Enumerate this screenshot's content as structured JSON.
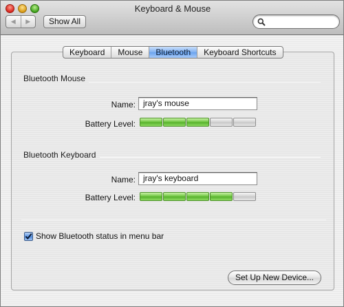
{
  "window": {
    "title": "Keyboard & Mouse"
  },
  "toolbar": {
    "back_icon": "back-arrow-icon",
    "forward_icon": "forward-arrow-icon",
    "show_all_label": "Show All",
    "search": {
      "value": "",
      "placeholder": "",
      "icon": "search-icon"
    }
  },
  "tabs": [
    {
      "label": "Keyboard",
      "active": false
    },
    {
      "label": "Mouse",
      "active": false
    },
    {
      "label": "Bluetooth",
      "active": true
    },
    {
      "label": "Keyboard Shortcuts",
      "active": false
    }
  ],
  "mouse_section": {
    "title": "Bluetooth Mouse",
    "name_label": "Name:",
    "name_value": "jray's mouse",
    "battery_label": "Battery Level:",
    "battery_segments_total": 5,
    "battery_segments_filled": 3
  },
  "keyboard_section": {
    "title": "Bluetooth Keyboard",
    "name_label": "Name:",
    "name_value": "jray's keyboard",
    "battery_label": "Battery Level:",
    "battery_segments_total": 5,
    "battery_segments_filled": 4
  },
  "status_checkbox": {
    "label": "Show Bluetooth status in menu bar",
    "checked": true
  },
  "setup_button_label": "Set Up New Device...",
  "colors": {
    "battery_on": "#6cc43d",
    "battery_off": "#d2d2d2",
    "tab_active": "#7fb0f1",
    "close": "#d8231c",
    "minimize": "#d89a14",
    "maximize": "#3fa11c"
  }
}
